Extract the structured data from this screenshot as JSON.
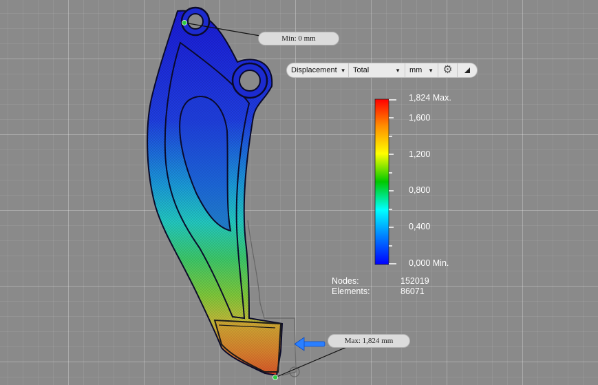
{
  "toolbar": {
    "result_type": "Displacement",
    "component": "Total",
    "unit": "mm",
    "settings_icon": "gear-icon",
    "collapse_icon": "triangle-icon"
  },
  "callouts": {
    "min_label": "Min: 0 mm",
    "max_label": "Max: 1,824 mm"
  },
  "legend": {
    "max_label": "1,824 Max.",
    "ticks": [
      "1,600",
      "1,200",
      "0,800",
      "0,400"
    ],
    "min_label": "0,000 Min.",
    "colors": [
      "#ff0000",
      "#ffa500",
      "#ffff00",
      "#00c800",
      "#00ffff",
      "#0080ff",
      "#0000ff"
    ]
  },
  "mesh": {
    "nodes_label": "Nodes:",
    "nodes_value": "152019",
    "elements_label": "Elements:",
    "elements_value": "86071"
  },
  "load_arrow_color": "#2a7fff"
}
